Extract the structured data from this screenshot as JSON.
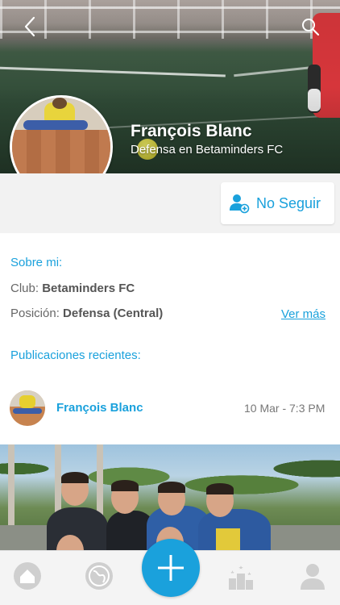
{
  "profile": {
    "name": "François Blanc",
    "role": "Defensa en Betaminders FC",
    "follow_label": "No Seguir"
  },
  "about": {
    "title": "Sobre mi:",
    "club_label": "Club:",
    "club_value": "Betaminders FC",
    "position_label": "Posición:",
    "position_value": "Defensa (Central)",
    "more_link": "Ver más"
  },
  "publications": {
    "title": "Publicaciones recientes:",
    "posts": [
      {
        "author": "François Blanc",
        "time": "10 Mar - 7:3 PM"
      }
    ]
  },
  "nav": {
    "icons": [
      "back-icon",
      "search-icon"
    ],
    "tabs": [
      "home-icon",
      "globe-icon",
      "plus-icon",
      "ranking-icon",
      "profile-icon"
    ]
  },
  "colors": {
    "accent": "#1aa1dc",
    "tab_icon": "#c9c9c9"
  }
}
